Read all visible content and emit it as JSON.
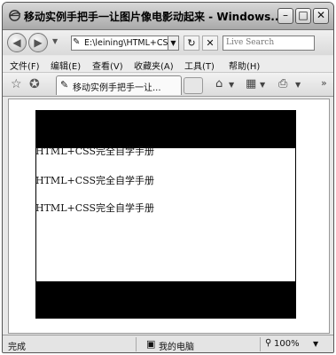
{
  "window": {
    "title": "移动实例手把手一让图片像电影动起来 - Windows..."
  },
  "address": {
    "value": "E:\\leining\\HTML+CS",
    "search_placeholder": "Live Search"
  },
  "menu": [
    "文件(F)",
    "编辑(E)",
    "查看(V)",
    "收藏夹(A)",
    "工具(T)",
    "帮助(H)"
  ],
  "tab": {
    "label": "移动实例手把手一让..."
  },
  "content": {
    "lines": [
      "HTML+CSS完全自学手册",
      "HTML+CSS完全自学手册",
      "HTML+CSS完全自学手册"
    ]
  },
  "status": {
    "left": "完成",
    "zone": "我的电脑",
    "zoom": "100%"
  },
  "icons": {
    "window": "ie-icon",
    "back": "back-arrow-icon",
    "forward": "forward-arrow-icon",
    "refresh": "refresh-icon",
    "stop": "stop-icon",
    "favorites": "star-icon",
    "add_favorite": "add-favorite-icon",
    "home": "home-icon",
    "feeds": "feeds-icon",
    "print": "print-icon"
  }
}
